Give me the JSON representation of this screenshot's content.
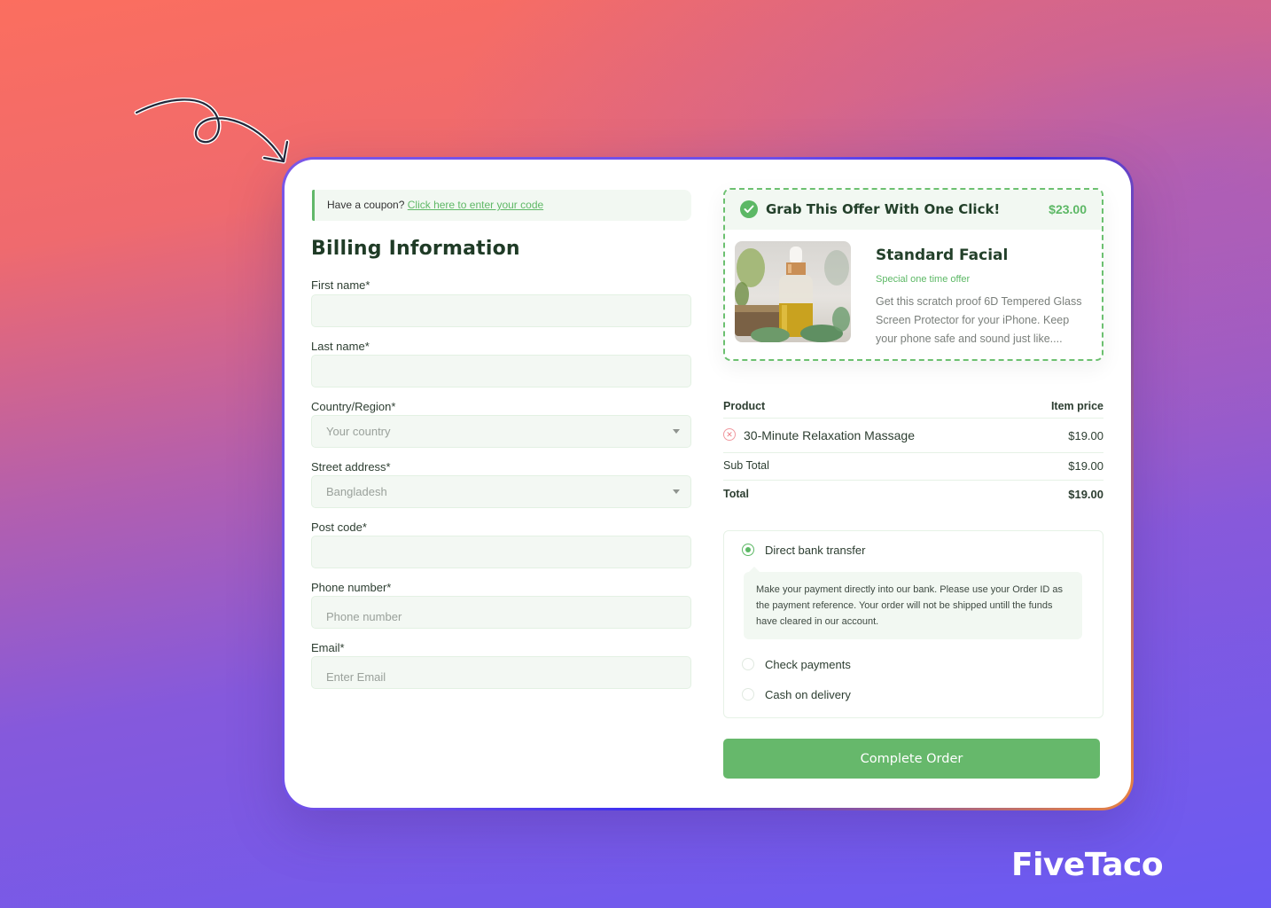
{
  "brand": {
    "name": "FiveTaco"
  },
  "colors": {
    "accent_green": "#5cb865",
    "button_green": "#66b86b",
    "field_bg": "#f3f8f3",
    "heading": "#23402a",
    "remove_red": "#ec7b83"
  },
  "coupon": {
    "prompt": "Have a coupon?",
    "link": "Click here to enter your code"
  },
  "billing": {
    "title": "Billing Information",
    "fields": {
      "first_name": {
        "label": "First name*",
        "value": "",
        "placeholder": ""
      },
      "last_name": {
        "label": "Last name*",
        "value": "",
        "placeholder": ""
      },
      "country": {
        "label": "Country/Region*",
        "selected": "Your country",
        "icon": "chevron-down-icon"
      },
      "street": {
        "label": "Street address*",
        "selected": "Bangladesh",
        "icon": "chevron-down-icon"
      },
      "post_code": {
        "label": "Post code*",
        "value": "",
        "placeholder": ""
      },
      "phone": {
        "label": "Phone number*",
        "value": "",
        "placeholder": "Phone number"
      },
      "email": {
        "label": "Email*",
        "value": "",
        "placeholder": "Enter Email"
      }
    }
  },
  "offer": {
    "icon": "check-circle-icon",
    "headline": "Grab This Offer With One Click!",
    "price": "$23.00",
    "product_name": "Standard Facial",
    "tagline": "Special one time offer",
    "description": "Get this scratch proof 6D Tempered Glass Screen Protector for your iPhone. Keep your phone safe and sound just like...."
  },
  "order": {
    "headers": {
      "product": "Product",
      "price": "Item price"
    },
    "items": [
      {
        "name": "30-Minute Relaxation Massage",
        "price": "$19.00",
        "remove_icon": "remove-circle-icon"
      }
    ],
    "subtotal": {
      "label": "Sub Total",
      "value": "$19.00"
    },
    "total": {
      "label": "Total",
      "value": "$19.00"
    }
  },
  "payment": {
    "methods": [
      {
        "label": "Direct bank transfer",
        "selected": true
      },
      {
        "label": "Check payments",
        "selected": false
      },
      {
        "label": "Cash on delivery",
        "selected": false
      }
    ],
    "bank_transfer_note": "Make your payment directly into our bank. Please use your Order ID as the payment reference.  Your order will not be shipped untill the funds have cleared in our account."
  },
  "actions": {
    "complete_order": "Complete Order"
  }
}
